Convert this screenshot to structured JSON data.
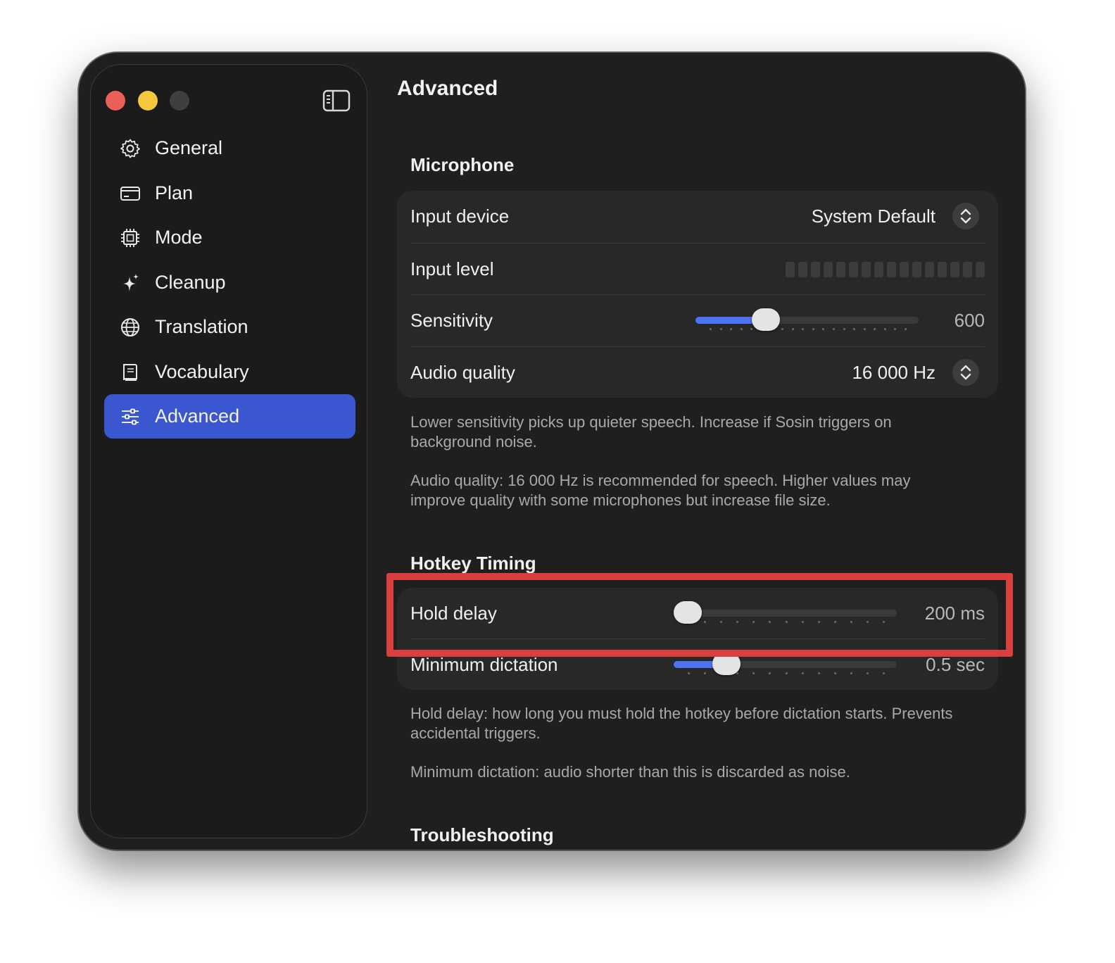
{
  "window": {
    "title": "Advanced"
  },
  "sidebar": {
    "items": [
      {
        "label": "General",
        "icon": "gear-icon",
        "active": false
      },
      {
        "label": "Plan",
        "icon": "credit-card-icon",
        "active": false
      },
      {
        "label": "Mode",
        "icon": "cpu-chip-icon",
        "active": false
      },
      {
        "label": "Cleanup",
        "icon": "sparkles-icon",
        "active": false
      },
      {
        "label": "Translation",
        "icon": "globe-icon",
        "active": false
      },
      {
        "label": "Vocabulary",
        "icon": "book-icon",
        "active": false
      },
      {
        "label": "Advanced",
        "icon": "sliders-icon",
        "active": true
      }
    ]
  },
  "microphone": {
    "heading": "Microphone",
    "input_device": {
      "label": "Input device",
      "value": "System Default"
    },
    "input_level": {
      "label": "Input level",
      "level": 0
    },
    "sensitivity": {
      "label": "Sensitivity",
      "value": "600",
      "fraction": 0.29
    },
    "audio_quality": {
      "label": "Audio quality",
      "value": "16 000 Hz"
    },
    "help1": "Lower sensitivity picks up quieter speech. Increase if Sosin triggers on background noise.",
    "help2": "Audio quality: 16 000 Hz is recommended for speech. Higher values may improve quality with some microphones but increase file size."
  },
  "hotkey": {
    "heading": "Hotkey Timing",
    "hold_delay": {
      "label": "Hold delay",
      "value": "200 ms",
      "fraction": 0.0
    },
    "min_dictation": {
      "label": "Minimum dictation",
      "value": "0.5 sec",
      "fraction": 0.2
    },
    "help1": "Hold delay: how long you must hold the hotkey before dictation starts. Prevents accidental triggers.",
    "help2": "Minimum dictation: audio shorter than this is discarded as noise."
  },
  "troubleshooting": {
    "heading": "Troubleshooting"
  },
  "colors": {
    "accent": "#4d73f2",
    "selection": "#3a57d0",
    "highlight": "#d9403d"
  }
}
